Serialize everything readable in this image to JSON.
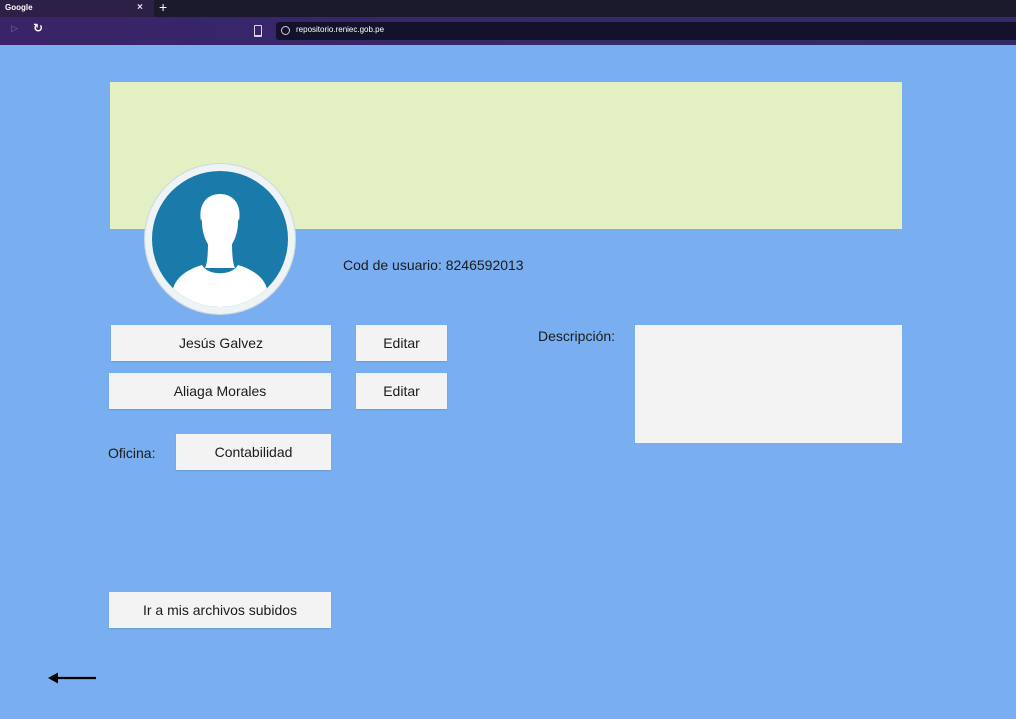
{
  "browser": {
    "tab_title": "Google",
    "tab_close": "×",
    "new_tab": "+",
    "forward_icon": "forward-arrow-icon",
    "reload_icon": "reload-icon",
    "url": "repositorio.reniec.gob.pe"
  },
  "profile": {
    "user_code_label": "Cod de usuario: 8246592013",
    "first_name": "Jesús Galvez",
    "last_name": "Aliaga Morales",
    "edit_label": "Editar",
    "office_label": "Oficina:",
    "office_value": "Contabilidad",
    "description_label": "Descripción:",
    "description_value": ""
  },
  "actions": {
    "files_button": "Ir a mis archivos subidos",
    "back_icon": "back-arrow-icon"
  },
  "colors": {
    "page_background": "#79aff0",
    "banner": "#e2f0c4",
    "avatar_fill": "#1a7aaa",
    "field_background": "#f3f3f3"
  }
}
